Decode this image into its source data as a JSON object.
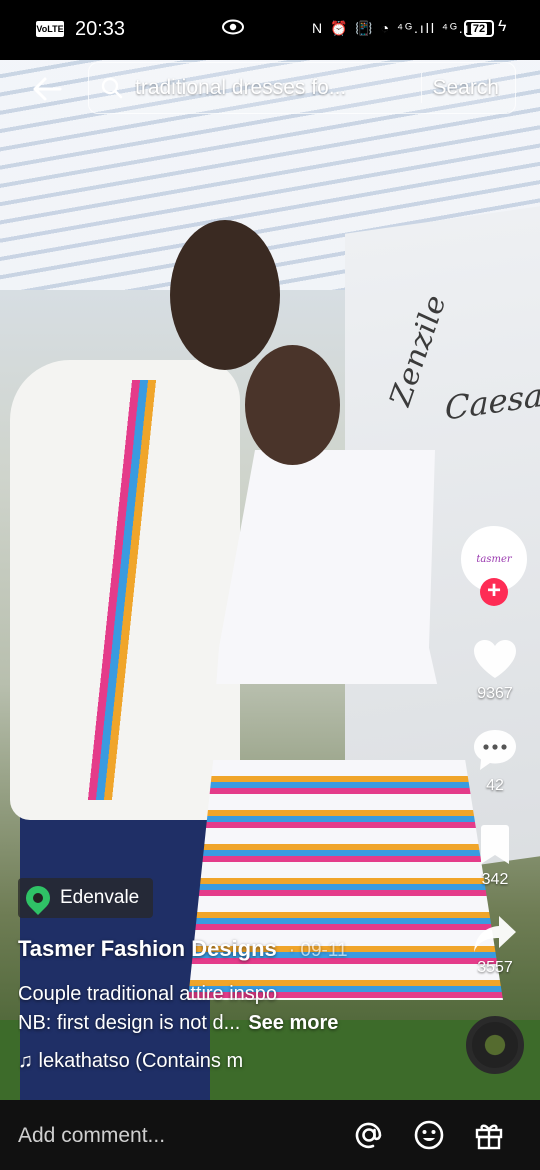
{
  "status_bar": {
    "volte": "VoLTE 2",
    "time": "20:33",
    "battery": "72",
    "system_icons": "N ⏰ 📳 ◔ ⁴ᴳ.ıll ⁴ᴳ.ıll"
  },
  "search": {
    "query": "traditional dresses fo...",
    "button_label": "Search"
  },
  "video": {
    "signature_1": "Zenzile",
    "signature_2": "Caesar",
    "amp": "&"
  },
  "rail": {
    "avatar_logo": "tasmer",
    "follow_label": "+",
    "likes": "9367",
    "comments": "42",
    "saves": "342",
    "shares": "3557"
  },
  "post": {
    "location": "Edenvale",
    "author": "Tasmer Fashion Designs",
    "date": "· 09-11",
    "caption_line_1": "Couple traditional attire inspo",
    "caption_line_2": "NB: first design is not d...",
    "see_more": "See more",
    "music": "♫ lekathatso (Contains m"
  },
  "comment_bar": {
    "placeholder": "Add comment..."
  },
  "colors": {
    "accent": "#fe2c55",
    "location_pin": "#2fc266"
  }
}
